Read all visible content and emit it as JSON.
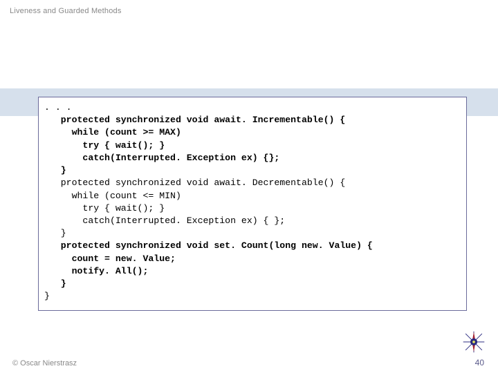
{
  "header": {
    "title": "Liveness and Guarded Methods"
  },
  "code": {
    "l1": ". . .",
    "l2": "protected synchronized void await. Incrementable() {",
    "l3": "while (count >= MAX)",
    "l4": "try { wait(); }",
    "l5": "catch(Interrupted. Exception ex) {};",
    "l6": "}",
    "l7": "protected synchronized void await. Decrementable() {",
    "l8": "while (count <= MIN)",
    "l9": "try { wait(); }",
    "l10": "catch(Interrupted. Exception ex) { };",
    "l11": "}",
    "l12": "protected synchronized void set. Count(long new. Value) {",
    "l13": "count = new. Value;",
    "l14": "notify. All();",
    "l15": "}",
    "l16": "}"
  },
  "footer": {
    "copyright": "© Oscar Nierstrasz",
    "page": "40"
  }
}
